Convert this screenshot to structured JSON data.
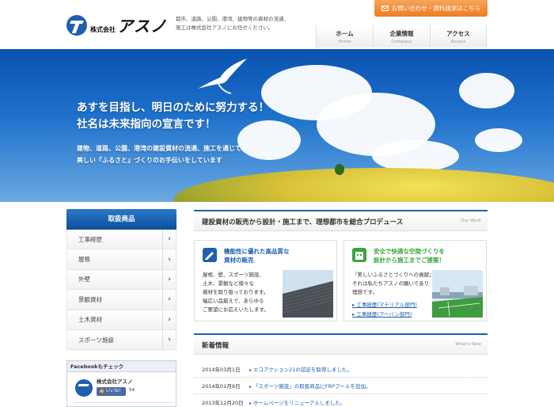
{
  "header": {
    "logo_small": "株式会社",
    "logo_big": "アスノ",
    "tagline_1": "都市、道路、公園、港湾、建物等の資材の流通、",
    "tagline_2": "施工は株式会社アスノにお任せください。",
    "contact_label": "お問い合わせ・資料請求はこちら",
    "nav": [
      {
        "jp": "ホーム",
        "en": "Home"
      },
      {
        "jp": "企業情報",
        "en": "Company"
      },
      {
        "jp": "アクセス",
        "en": "Access"
      }
    ]
  },
  "hero": {
    "title_1": "あすを目指し、明日のために努力する！",
    "title_2": "社名は未来指向の宣言です！",
    "sub_1": "建物、道路、公園、港湾の建設資材の流通、施工を通じて",
    "sub_2": "美しい『ふるさと』づくりのお手伝いをしています"
  },
  "sidebar": {
    "heading": "取扱商品",
    "items": [
      {
        "label": "工事経歴"
      },
      {
        "label": "屋根"
      },
      {
        "label": "外壁"
      },
      {
        "label": "景観資材"
      },
      {
        "label": "土木資材"
      },
      {
        "label": "スポーツ施設"
      }
    ],
    "facebook": {
      "heading": "Facebookもチェック",
      "page_name": "株式会社アスノ",
      "like_label": "いいね！",
      "like_count": "54"
    }
  },
  "work": {
    "title": "建設資材の販売から設計・施工まで、理想都市を総合プロデュース",
    "en": "Our Work",
    "card_left": {
      "title_1": "機能性に優れた高品質な",
      "title_2": "資材の販売",
      "text": [
        "屋根、壁、スポーツ施設、",
        "土木、景観など様々な",
        "資材を取り扱っております。",
        "幅広い品揃えで、あらゆる",
        "ご要望にお応えいたします。"
      ],
      "accent": "#1f5fae"
    },
    "card_right": {
      "title_1": "安全で快適な空間づくりを",
      "title_2": "設計から施工までご提案！",
      "text": [
        "『美しいふるさとづくりへの貢献』",
        "それは私たちアスノの願いであり",
        "理想です。"
      ],
      "link_1": "工事経歴(マテリアル部門)",
      "link_2": "工事経歴(アーバン部門)",
      "accent": "#3aa53a"
    }
  },
  "news": {
    "title": "新着情報",
    "en": "What's New",
    "items": [
      {
        "date": "2014年03月1日",
        "text": "エコアクション21の認証を取得しました。"
      },
      {
        "date": "2014年01月9日",
        "text": "「スポーツ施設」の取扱商品にFRPプールを追加。"
      },
      {
        "date": "2013年12月20日",
        "text": "ホームページをリニューアルしました。"
      }
    ]
  }
}
